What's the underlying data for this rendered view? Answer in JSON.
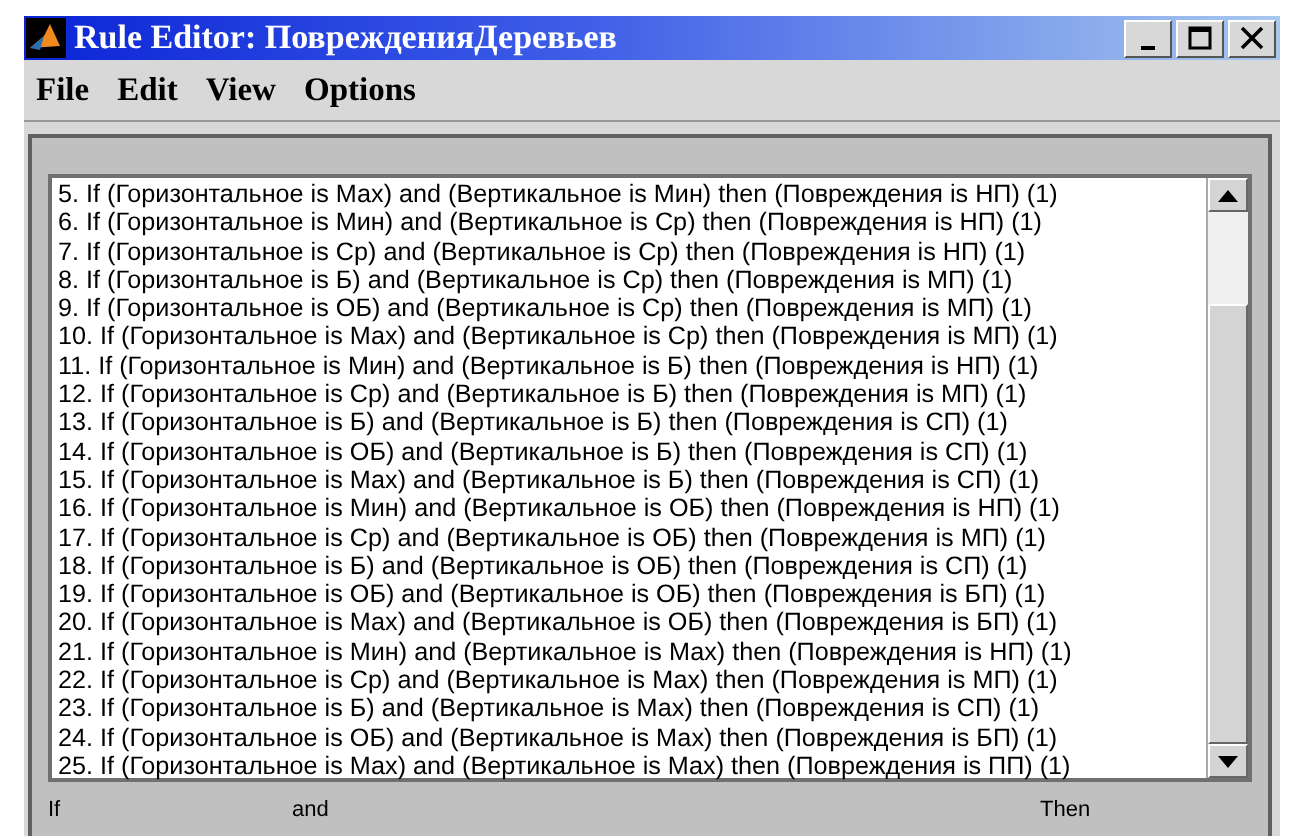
{
  "window": {
    "title": "Rule Editor: ПоврежденияДеревьев"
  },
  "menu": [
    "File",
    "Edit",
    "View",
    "Options"
  ],
  "rules": [
    "5. If (Горизонтальное is Мах) and (Вертикальное is Мин) then (Повреждения is НП) (1)",
    "6. If (Горизонтальное is Мин) and (Вертикальное is Ср) then (Повреждения is НП) (1)",
    "7. If (Горизонтальное is Ср) and (Вертикальное is Ср) then (Повреждения is НП) (1)",
    "8. If (Горизонтальное is Б) and (Вертикальное is Ср) then (Повреждения is МП) (1)",
    "9. If (Горизонтальное is ОБ) and (Вертикальное is Ср) then (Повреждения is МП) (1)",
    "10. If (Горизонтальное is Мах) and (Вертикальное is Ср) then (Повреждения is МП) (1)",
    "11. If (Горизонтальное is Мин) and (Вертикальное is Б) then (Повреждения is НП) (1)",
    "12. If (Горизонтальное is Ср) and (Вертикальное is Б) then (Повреждения is МП) (1)",
    "13. If (Горизонтальное is Б) and (Вертикальное is Б) then (Повреждения is СП) (1)",
    "14. If (Горизонтальное is ОБ) and (Вертикальное is Б) then (Повреждения is СП) (1)",
    "15. If (Горизонтальное is Мах) and (Вертикальное is Б) then (Повреждения is СП) (1)",
    "16. If (Горизонтальное is Мин) and (Вертикальное is ОБ) then (Повреждения is НП) (1)",
    "17. If (Горизонтальное is Ср) and (Вертикальное is ОБ) then (Повреждения is МП) (1)",
    "18. If (Горизонтальное is Б) and (Вертикальное is ОБ) then (Повреждения is СП) (1)",
    "19. If (Горизонтальное is ОБ) and (Вертикальное is ОБ) then (Повреждения is БП) (1)",
    "20. If (Горизонтальное is Мах) and (Вертикальное is ОБ) then (Повреждения is БП) (1)",
    "21. If (Горизонтальное is Мин) and (Вертикальное is Мах) then (Повреждения is НП) (1)",
    "22. If (Горизонтальное is Ср) and (Вертикальное is Мах) then (Повреждения is МП) (1)",
    "23. If (Горизонтальное is Б) and (Вертикальное is Мах) then (Повреждения is СП) (1)",
    "24. If (Горизонтальное is ОБ) and (Вертикальное is Мах) then (Повреждения is БП) (1)",
    "25. If (Горизонтальное is Мах) and (Вертикальное is Мах) then (Повреждения is ПП) (1)"
  ],
  "labels": [
    "If",
    "and",
    "Then"
  ]
}
